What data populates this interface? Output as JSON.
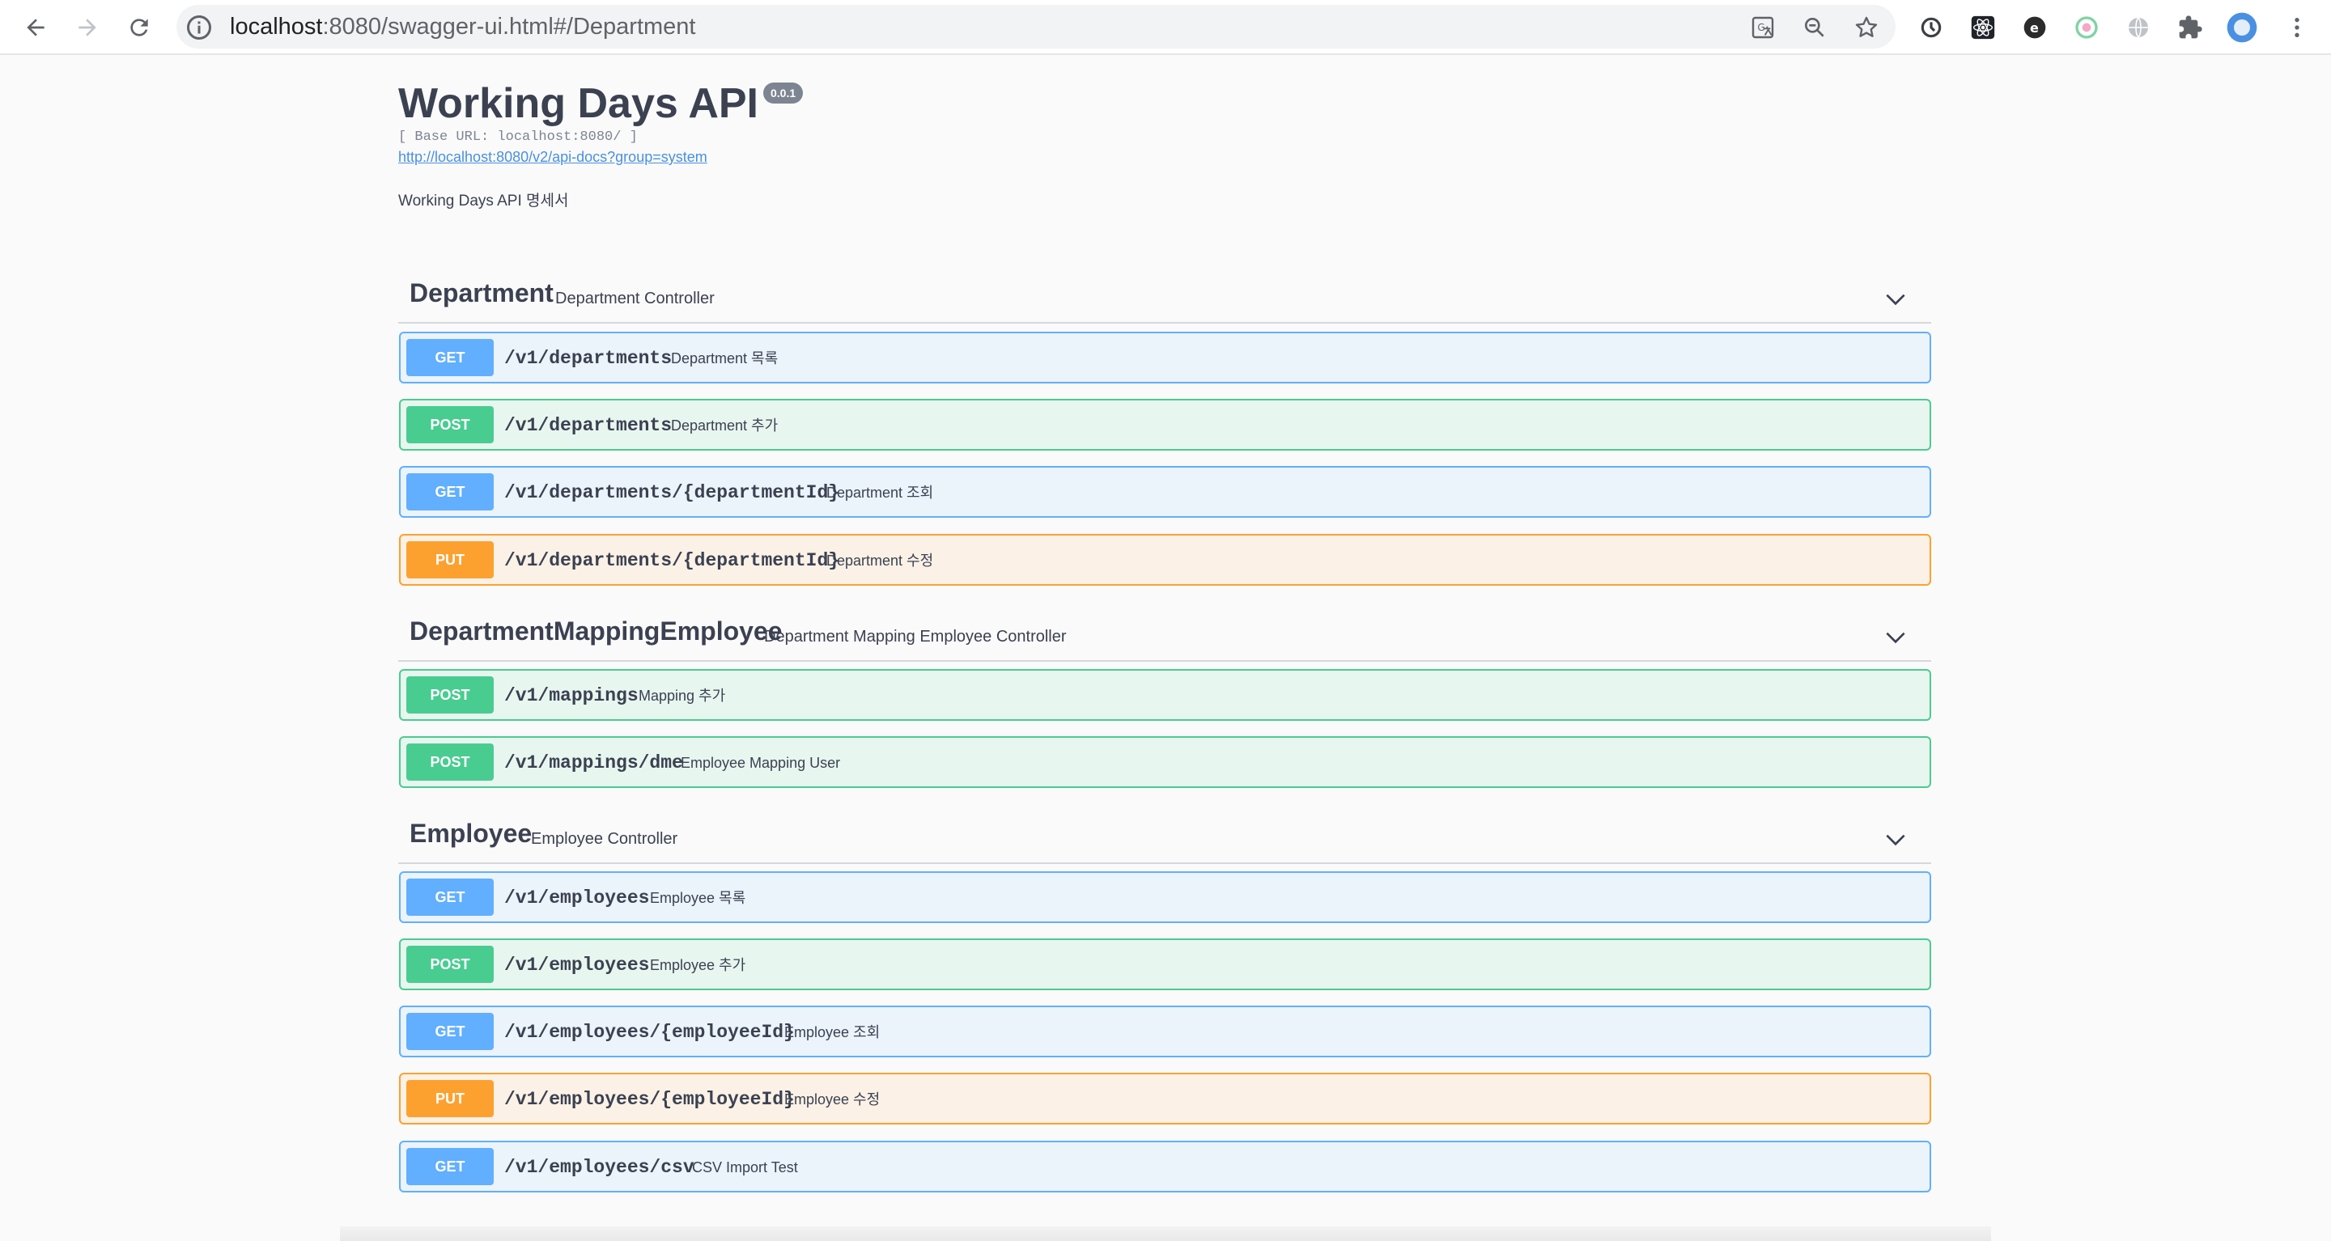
{
  "browser": {
    "url_host": "localhost",
    "url_path": ":8080/swagger-ui.html#/Department",
    "icons": [
      "back-arrow-icon",
      "forward-arrow-icon",
      "reload-icon",
      "site-info-icon",
      "translate-icon",
      "zoom-out-icon",
      "bookmark-star-icon",
      "extension-icons",
      "puzzle-extensions-icon",
      "profile-avatar-icon",
      "more-menu-icon"
    ]
  },
  "info": {
    "title": "Working Days API",
    "version": "0.0.1",
    "base_url": "[ Base URL: localhost:8080/ ]",
    "docs_link": "http://localhost:8080/v2/api-docs?group=system",
    "description": "Working Days API 명세서"
  },
  "tags": [
    {
      "name": "Department",
      "description": "Department Controller",
      "operations": [
        {
          "method": "GET",
          "path": "/v1/departments",
          "summary": "Department 목록"
        },
        {
          "method": "POST",
          "path": "/v1/departments",
          "summary": "Department 추가"
        },
        {
          "method": "GET",
          "path": "/v1/departments/{departmentId}",
          "summary": "Department 조회"
        },
        {
          "method": "PUT",
          "path": "/v1/departments/{departmentId}",
          "summary": "Department 수정"
        }
      ]
    },
    {
      "name": "DepartmentMappingEmployee",
      "description": "Department Mapping Employee Controller",
      "operations": [
        {
          "method": "POST",
          "path": "/v1/mappings",
          "summary": "Mapping 추가"
        },
        {
          "method": "POST",
          "path": "/v1/mappings/dme",
          "summary": "Employee Mapping User"
        }
      ]
    },
    {
      "name": "Employee",
      "description": "Employee Controller",
      "operations": [
        {
          "method": "GET",
          "path": "/v1/employees",
          "summary": "Employee 목록"
        },
        {
          "method": "POST",
          "path": "/v1/employees",
          "summary": "Employee 추가"
        },
        {
          "method": "GET",
          "path": "/v1/employees/{employeeId}",
          "summary": "Employee 조회"
        },
        {
          "method": "PUT",
          "path": "/v1/employees/{employeeId}",
          "summary": "Employee 수정"
        },
        {
          "method": "GET",
          "path": "/v1/employees/csv",
          "summary": "CSV Import Test"
        }
      ]
    }
  ],
  "colors": {
    "get": "#61affe",
    "post": "#49cc90",
    "put": "#fca130",
    "text": "#3b4151"
  }
}
